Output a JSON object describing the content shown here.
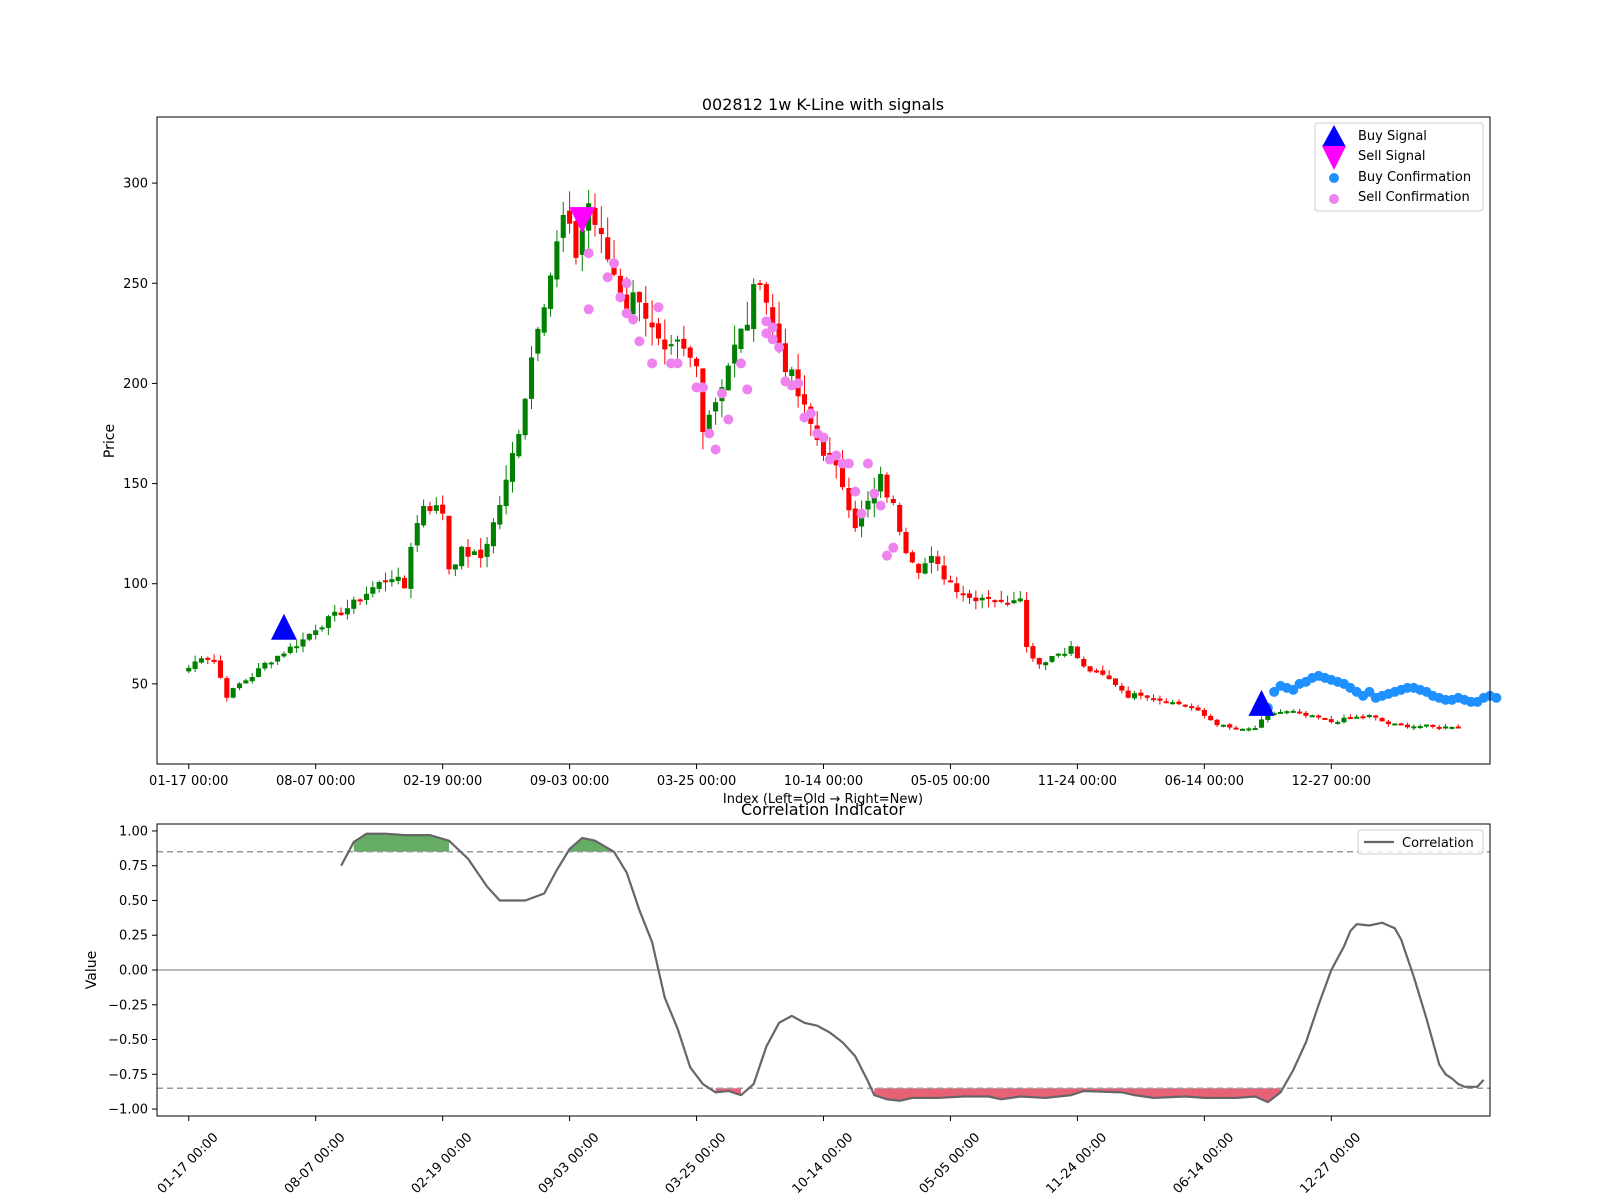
{
  "chart_data": [
    {
      "type": "candlestick",
      "title": "002812 1w K-Line with signals",
      "xlabel": "Index (Left=Old → Right=New)",
      "ylabel": "Price",
      "xlim": [
        -5,
        205
      ],
      "ylim": [
        10,
        333
      ],
      "yticks": [
        50,
        100,
        150,
        200,
        250,
        300
      ],
      "xtick_labels": [
        "01-17 00:00",
        "08-07 00:00",
        "02-19 00:00",
        "09-03 00:00",
        "03-25 00:00",
        "10-14 00:00",
        "05-05 00:00",
        "11-24 00:00",
        "06-14 00:00",
        "12-27 00:00"
      ],
      "xtick_index": [
        0,
        20,
        40,
        60,
        80,
        100,
        120,
        140,
        160,
        180
      ],
      "close_anchors": [
        [
          0,
          58
        ],
        [
          2,
          64
        ],
        [
          4,
          62
        ],
        [
          6,
          44
        ],
        [
          8,
          50
        ],
        [
          10,
          54
        ],
        [
          12,
          60
        ],
        [
          15,
          66
        ],
        [
          18,
          72
        ],
        [
          20,
          78
        ],
        [
          23,
          84
        ],
        [
          26,
          90
        ],
        [
          29,
          98
        ],
        [
          32,
          104
        ],
        [
          34,
          98
        ],
        [
          35,
          120
        ],
        [
          37,
          140
        ],
        [
          40,
          136
        ],
        [
          41,
          108
        ],
        [
          43,
          116
        ],
        [
          46,
          113
        ],
        [
          48,
          130
        ],
        [
          50,
          150
        ],
        [
          52,
          178
        ],
        [
          53,
          195
        ],
        [
          55,
          232
        ],
        [
          57,
          255
        ],
        [
          59,
          282
        ],
        [
          61,
          265
        ],
        [
          63,
          290
        ],
        [
          65,
          270
        ],
        [
          67,
          255
        ],
        [
          69,
          240
        ],
        [
          71,
          245
        ],
        [
          73,
          225
        ],
        [
          75,
          212
        ],
        [
          77,
          218
        ],
        [
          80,
          208
        ],
        [
          81,
          180
        ],
        [
          83,
          192
        ],
        [
          85,
          210
        ],
        [
          88,
          232
        ],
        [
          90,
          256
        ],
        [
          92,
          228
        ],
        [
          94,
          210
        ],
        [
          97,
          186
        ],
        [
          99,
          172
        ],
        [
          101,
          162
        ],
        [
          103,
          150
        ],
        [
          105,
          130
        ],
        [
          107,
          140
        ],
        [
          109,
          152
        ],
        [
          111,
          138
        ],
        [
          113,
          118
        ],
        [
          115,
          108
        ],
        [
          117,
          112
        ],
        [
          119,
          104
        ],
        [
          121,
          98
        ],
        [
          123,
          93
        ],
        [
          126,
          94
        ],
        [
          128,
          90
        ],
        [
          131,
          95
        ],
        [
          132,
          68
        ],
        [
          134,
          60
        ],
        [
          136,
          64
        ],
        [
          139,
          68
        ],
        [
          141,
          58
        ],
        [
          144,
          54
        ],
        [
          146,
          50
        ],
        [
          148,
          44
        ],
        [
          150,
          45
        ],
        [
          153,
          42
        ],
        [
          156,
          40
        ],
        [
          158,
          38
        ],
        [
          160,
          34
        ],
        [
          162,
          30
        ],
        [
          164,
          28
        ],
        [
          166,
          27
        ],
        [
          168,
          28
        ],
        [
          170,
          35
        ],
        [
          172,
          36
        ],
        [
          174,
          36
        ],
        [
          176,
          34
        ],
        [
          178,
          33
        ],
        [
          180,
          31
        ],
        [
          183,
          33
        ],
        [
          186,
          34
        ],
        [
          189,
          30
        ],
        [
          192,
          29
        ],
        [
          195,
          29
        ],
        [
          197,
          28
        ],
        [
          199,
          29
        ]
      ],
      "series": [
        {
          "name": "Buy Signal",
          "marker": "triangle-up",
          "color": "#0000ff",
          "points": [
            [
              15,
              78
            ],
            [
              169,
              40
            ]
          ]
        },
        {
          "name": "Sell Signal",
          "marker": "triangle-down",
          "color": "#ff00ff",
          "points": [
            [
              62,
              282
            ]
          ]
        },
        {
          "name": "Buy Confirmation",
          "marker": "circle",
          "color": "#1e90ff",
          "points": [
            [
              170,
              38
            ],
            [
              171,
              46
            ],
            [
              172,
              49
            ],
            [
              173,
              48
            ],
            [
              174,
              47
            ],
            [
              175,
              50
            ],
            [
              176,
              51
            ],
            [
              177,
              53
            ],
            [
              178,
              54
            ],
            [
              179,
              53
            ],
            [
              180,
              52
            ],
            [
              181,
              51
            ],
            [
              182,
              50
            ],
            [
              183,
              48
            ],
            [
              184,
              46
            ],
            [
              185,
              44
            ],
            [
              186,
              46
            ],
            [
              187,
              43
            ],
            [
              188,
              44
            ],
            [
              189,
              45
            ],
            [
              190,
              46
            ],
            [
              191,
              47
            ],
            [
              192,
              48
            ],
            [
              193,
              48
            ],
            [
              194,
              47
            ],
            [
              195,
              46
            ],
            [
              196,
              44
            ],
            [
              197,
              43
            ],
            [
              198,
              42
            ],
            [
              199,
              42
            ],
            [
              200,
              43
            ],
            [
              201,
              42
            ],
            [
              202,
              41
            ],
            [
              203,
              41
            ],
            [
              204,
              43
            ],
            [
              205,
              44
            ],
            [
              206,
              43
            ]
          ]
        },
        {
          "name": "Sell Confirmation",
          "marker": "circle",
          "color": "#ee82ee",
          "points": [
            [
              63,
              265
            ],
            [
              63,
              237
            ],
            [
              66,
              253
            ],
            [
              67,
              260
            ],
            [
              68,
              243
            ],
            [
              69,
              250
            ],
            [
              69,
              235
            ],
            [
              70,
              232
            ],
            [
              71,
              221
            ],
            [
              73,
              210
            ],
            [
              74,
              238
            ],
            [
              76,
              210
            ],
            [
              77,
              210
            ],
            [
              80,
              198
            ],
            [
              81,
              198
            ],
            [
              82,
              175
            ],
            [
              83,
              167
            ],
            [
              84,
              195
            ],
            [
              85,
              182
            ],
            [
              87,
              210
            ],
            [
              88,
              197
            ],
            [
              91,
              225
            ],
            [
              91,
              231
            ],
            [
              92,
              228
            ],
            [
              92,
              222
            ],
            [
              93,
              218
            ],
            [
              94,
              201
            ],
            [
              95,
              199
            ],
            [
              96,
              200
            ],
            [
              97,
              183
            ],
            [
              98,
              185
            ],
            [
              99,
              175
            ],
            [
              100,
              173
            ],
            [
              101,
              162
            ],
            [
              102,
              164
            ],
            [
              103,
              160
            ],
            [
              104,
              160
            ],
            [
              105,
              146
            ],
            [
              106,
              135
            ],
            [
              107,
              160
            ],
            [
              108,
              145
            ],
            [
              109,
              139
            ],
            [
              110,
              114
            ],
            [
              111,
              118
            ]
          ]
        }
      ],
      "legend": "top-right"
    },
    {
      "type": "line",
      "title": "Correlation Indicator",
      "ylabel": "Value",
      "xlim": [
        -5,
        205
      ],
      "ylim": [
        -1.05,
        1.05
      ],
      "yticks": [
        -1.0,
        -0.75,
        -0.5,
        -0.25,
        0.0,
        0.25,
        0.5,
        0.75,
        1.0
      ],
      "ytick_labels": [
        "−1.00",
        "−0.75",
        "−0.50",
        "−0.25",
        "0.00",
        "0.25",
        "0.50",
        "0.75",
        "1.00"
      ],
      "xtick_labels": [
        "01-17 00:00",
        "08-07 00:00",
        "02-19 00:00",
        "09-03 00:00",
        "03-25 00:00",
        "10-14 00:00",
        "05-05 00:00",
        "11-24 00:00",
        "06-14 00:00",
        "12-27 00:00"
      ],
      "thresholds": [
        0.85,
        -0.85
      ],
      "series": [
        {
          "name": "Correlation",
          "color": "#666666",
          "points": [
            [
              24,
              0.75
            ],
            [
              26,
              0.92
            ],
            [
              28,
              0.98
            ],
            [
              31,
              0.98
            ],
            [
              34,
              0.97
            ],
            [
              38,
              0.97
            ],
            [
              41,
              0.93
            ],
            [
              44,
              0.8
            ],
            [
              47,
              0.6
            ],
            [
              49,
              0.5
            ],
            [
              53,
              0.5
            ],
            [
              56,
              0.55
            ],
            [
              58,
              0.72
            ],
            [
              60,
              0.87
            ],
            [
              62,
              0.95
            ],
            [
              64,
              0.93
            ],
            [
              67,
              0.85
            ],
            [
              69,
              0.7
            ],
            [
              71,
              0.43
            ],
            [
              73,
              0.2
            ],
            [
              74,
              0.0
            ],
            [
              75,
              -0.2
            ],
            [
              77,
              -0.42
            ],
            [
              79,
              -0.7
            ],
            [
              81,
              -0.82
            ],
            [
              83,
              -0.88
            ],
            [
              85,
              -0.87
            ],
            [
              87,
              -0.9
            ],
            [
              89,
              -0.82
            ],
            [
              91,
              -0.55
            ],
            [
              93,
              -0.38
            ],
            [
              95,
              -0.33
            ],
            [
              97,
              -0.38
            ],
            [
              99,
              -0.4
            ],
            [
              101,
              -0.45
            ],
            [
              103,
              -0.52
            ],
            [
              105,
              -0.62
            ],
            [
              107,
              -0.8
            ],
            [
              108,
              -0.9
            ],
            [
              110,
              -0.93
            ],
            [
              112,
              -0.94
            ],
            [
              114,
              -0.92
            ],
            [
              118,
              -0.92
            ],
            [
              122,
              -0.91
            ],
            [
              126,
              -0.91
            ],
            [
              128,
              -0.93
            ],
            [
              131,
              -0.91
            ],
            [
              135,
              -0.92
            ],
            [
              139,
              -0.9
            ],
            [
              141,
              -0.87
            ],
            [
              147,
              -0.88
            ],
            [
              149,
              -0.9
            ],
            [
              152,
              -0.92
            ],
            [
              157,
              -0.91
            ],
            [
              160,
              -0.92
            ],
            [
              165,
              -0.92
            ],
            [
              168,
              -0.91
            ],
            [
              170,
              -0.95
            ],
            [
              172,
              -0.88
            ],
            [
              174,
              -0.72
            ],
            [
              176,
              -0.52
            ],
            [
              178,
              -0.25
            ],
            [
              180,
              0.0
            ],
            [
              182,
              0.17
            ],
            [
              183,
              0.28
            ],
            [
              184,
              0.33
            ],
            [
              186,
              0.32
            ],
            [
              188,
              0.34
            ],
            [
              190,
              0.3
            ],
            [
              191,
              0.22
            ],
            [
              193,
              -0.05
            ],
            [
              195,
              -0.35
            ],
            [
              197,
              -0.68
            ],
            [
              198,
              -0.75
            ],
            [
              199,
              -0.78
            ],
            [
              200,
              -0.82
            ],
            [
              201,
              -0.84
            ],
            [
              202,
              -0.84
            ],
            [
              203,
              -0.84
            ],
            [
              204,
              -0.79
            ]
          ]
        }
      ],
      "fill_above_color": "#4a9e4a",
      "fill_below_color": "#e3475f",
      "legend": "top-right"
    }
  ],
  "colors": {
    "up": "#008000",
    "down": "#ff0000",
    "threshold_line": "#999999",
    "zero_line": "#a0a0a0"
  }
}
